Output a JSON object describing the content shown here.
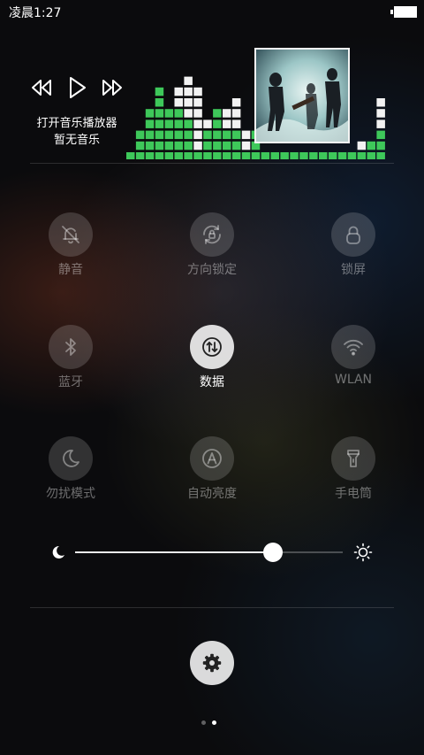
{
  "status_bar": {
    "time": "凌晨1:27",
    "battery_icon": "battery-full-icon"
  },
  "music": {
    "prev_icon": "rewind-icon",
    "play_icon": "play-icon",
    "next_icon": "fast-forward-icon",
    "open_player_label": "打开音乐播放器",
    "no_music_label": "暂无音乐",
    "album_art": "album-cover-image",
    "equalizer": {
      "colors": {
        "green": "#3ec85a",
        "white": "#f2f2f2"
      },
      "columns": [
        {
          "green": 1,
          "white": 0
        },
        {
          "green": 3,
          "white": 0
        },
        {
          "green": 5,
          "white": 0
        },
        {
          "green": 7,
          "white": 0
        },
        {
          "green": 5,
          "white": 0
        },
        {
          "green": 5,
          "white": 2
        },
        {
          "green": 4,
          "white": 4
        },
        {
          "green": 1,
          "white": 6
        },
        {
          "green": 3,
          "white": 1
        },
        {
          "green": 5,
          "white": 0
        },
        {
          "green": 3,
          "white": 2
        },
        {
          "green": 3,
          "white": 3
        },
        {
          "green": 1,
          "white": 2
        },
        {
          "green": 3,
          "white": 0
        },
        {
          "green": 1,
          "white": 4
        },
        {
          "green": 3,
          "white": 2
        },
        {
          "green": 1,
          "white": 0
        },
        {
          "green": 2,
          "white": 0
        },
        {
          "green": 2,
          "white": 2
        },
        {
          "green": 1,
          "white": 0
        },
        {
          "green": 1,
          "white": 0
        },
        {
          "green": 1,
          "white": 2
        },
        {
          "green": 1,
          "white": 1
        },
        {
          "green": 1,
          "white": 3
        },
        {
          "green": 1,
          "white": 1
        },
        {
          "green": 2,
          "white": 0
        },
        {
          "green": 3,
          "white": 3
        }
      ]
    }
  },
  "toggles": [
    {
      "id": "mute",
      "label": "静音",
      "icon": "bell-off-icon",
      "active": false
    },
    {
      "id": "rotation-lock",
      "label": "方向锁定",
      "icon": "rotation-lock-icon",
      "active": false
    },
    {
      "id": "lock-screen",
      "label": "锁屏",
      "icon": "lock-icon",
      "active": false
    },
    {
      "id": "bluetooth",
      "label": "蓝牙",
      "icon": "bluetooth-icon",
      "active": false
    },
    {
      "id": "data",
      "label": "数据",
      "icon": "mobile-data-icon",
      "active": true
    },
    {
      "id": "wlan",
      "label": "WLAN",
      "icon": "wifi-icon",
      "active": false
    },
    {
      "id": "do-not-disturb",
      "label": "勿扰模式",
      "icon": "moon-icon",
      "active": false
    },
    {
      "id": "auto-brightness",
      "label": "自动亮度",
      "icon": "auto-brightness-icon",
      "active": false
    },
    {
      "id": "flashlight",
      "label": "手电筒",
      "icon": "flashlight-icon",
      "active": false
    }
  ],
  "brightness": {
    "level": 0.74,
    "low_icon": "moon-icon",
    "high_icon": "sun-icon"
  },
  "settings_icon": "gear-icon",
  "pager": {
    "total": 2,
    "current": 2
  }
}
